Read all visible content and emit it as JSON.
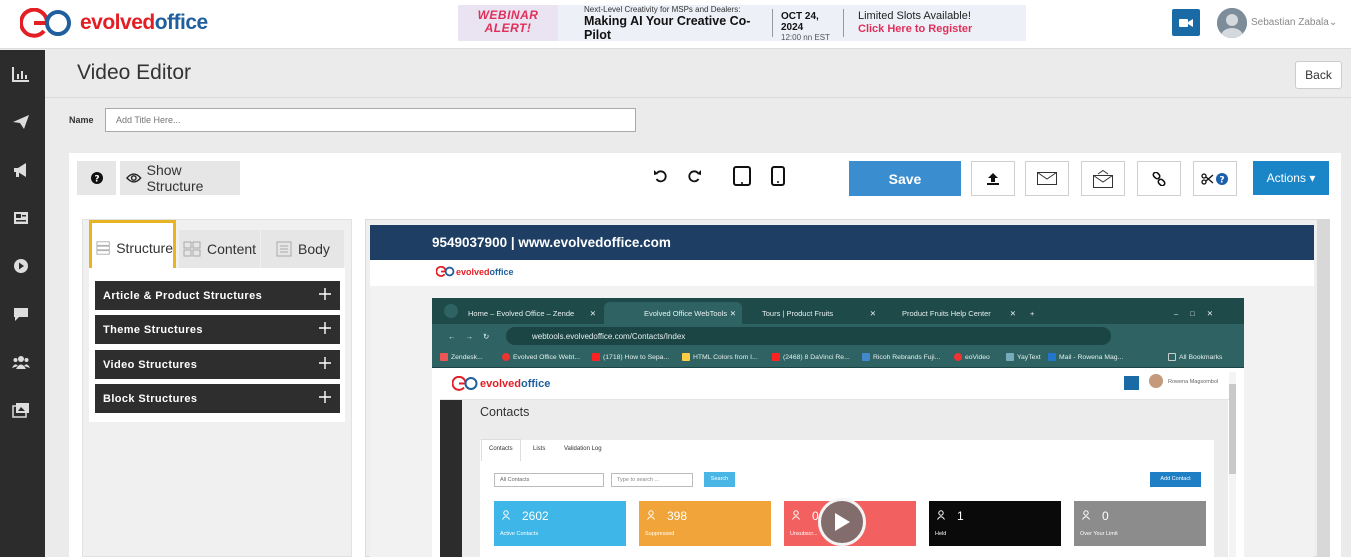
{
  "brand": {
    "logo_text_red": "evolved",
    "logo_text_blue": "office"
  },
  "banner": {
    "alert_line1": "WEBINAR",
    "alert_line2": "ALERT!",
    "tagline": "Next-Level Creativity for MSPs and Dealers:",
    "headline": "Making AI Your Creative Co-Pilot",
    "date": "OCT 24, 2024",
    "time": "12:00 nn EST",
    "limited": "Limited Slots Available!",
    "cta": "Click Here to Register"
  },
  "user": {
    "name": "Sebastian Zabala"
  },
  "page": {
    "title": "Video Editor",
    "back_label": "Back"
  },
  "name_field": {
    "label": "Name",
    "placeholder": "Add Title Here..."
  },
  "toolbar": {
    "show_structure": "Show Structure",
    "save": "Save",
    "actions": "Actions"
  },
  "panel": {
    "tabs": [
      {
        "label": "Structure"
      },
      {
        "label": "Content"
      },
      {
        "label": "Body"
      }
    ],
    "structures": [
      {
        "label": "Article & Product Structures"
      },
      {
        "label": "Theme Structures"
      },
      {
        "label": "Video Structures"
      },
      {
        "label": "Block Structures"
      }
    ]
  },
  "preview": {
    "header_text": "9549037900 | www.evolvedoffice.com",
    "logo_red": "evolved",
    "logo_blue": "office",
    "browser": {
      "tabs": [
        {
          "label": "Home – Evolved Office – Zende"
        },
        {
          "label": "Evolved Office WebTools"
        },
        {
          "label": "Tours | Product Fruits"
        },
        {
          "label": "Product Fruits Help Center"
        }
      ],
      "url": "webtools.evolvedoffice.com/Contacts/Index",
      "bookmarks": [
        {
          "label": "Zendesk..."
        },
        {
          "label": "Evolved Office Webt..."
        },
        {
          "label": "(1718) How to Sepa..."
        },
        {
          "label": "HTML Colors from I..."
        },
        {
          "label": "(2468) 8 DaVinci Re..."
        },
        {
          "label": "Ricoh Rebrands Fuji..."
        },
        {
          "label": "eoVideo"
        },
        {
          "label": "YayText"
        },
        {
          "label": "Mail - Rowena Mag..."
        },
        {
          "label": "All Bookmarks"
        }
      ]
    },
    "app": {
      "user_name": "Rowena Magsombol",
      "title": "Contacts",
      "tabs": [
        {
          "label": "Contacts"
        },
        {
          "label": "Lists"
        },
        {
          "label": "Validation Log"
        }
      ],
      "select_value": "All Contacts",
      "search_placeholder": "Type to search ...",
      "search_btn": "Search",
      "add_btn": "Add Contact",
      "stats": [
        {
          "value": "2602",
          "label": "Active Contacts",
          "color": "#3fb6e8"
        },
        {
          "value": "398",
          "label": "Suppressed",
          "color": "#f0a43a"
        },
        {
          "value": "0",
          "label": "Unsubscr...",
          "color": "#f2605f"
        },
        {
          "value": "1",
          "label": "Held",
          "color": "#0a0a0a"
        },
        {
          "value": "0",
          "label": "Over Your Limit",
          "color": "#8c8c8c"
        }
      ]
    }
  },
  "colors": {
    "brand_red": "#e31e24",
    "brand_blue": "#1f5f9e",
    "save_blue": "#3a8ed0",
    "highlight": "#e8b423"
  }
}
